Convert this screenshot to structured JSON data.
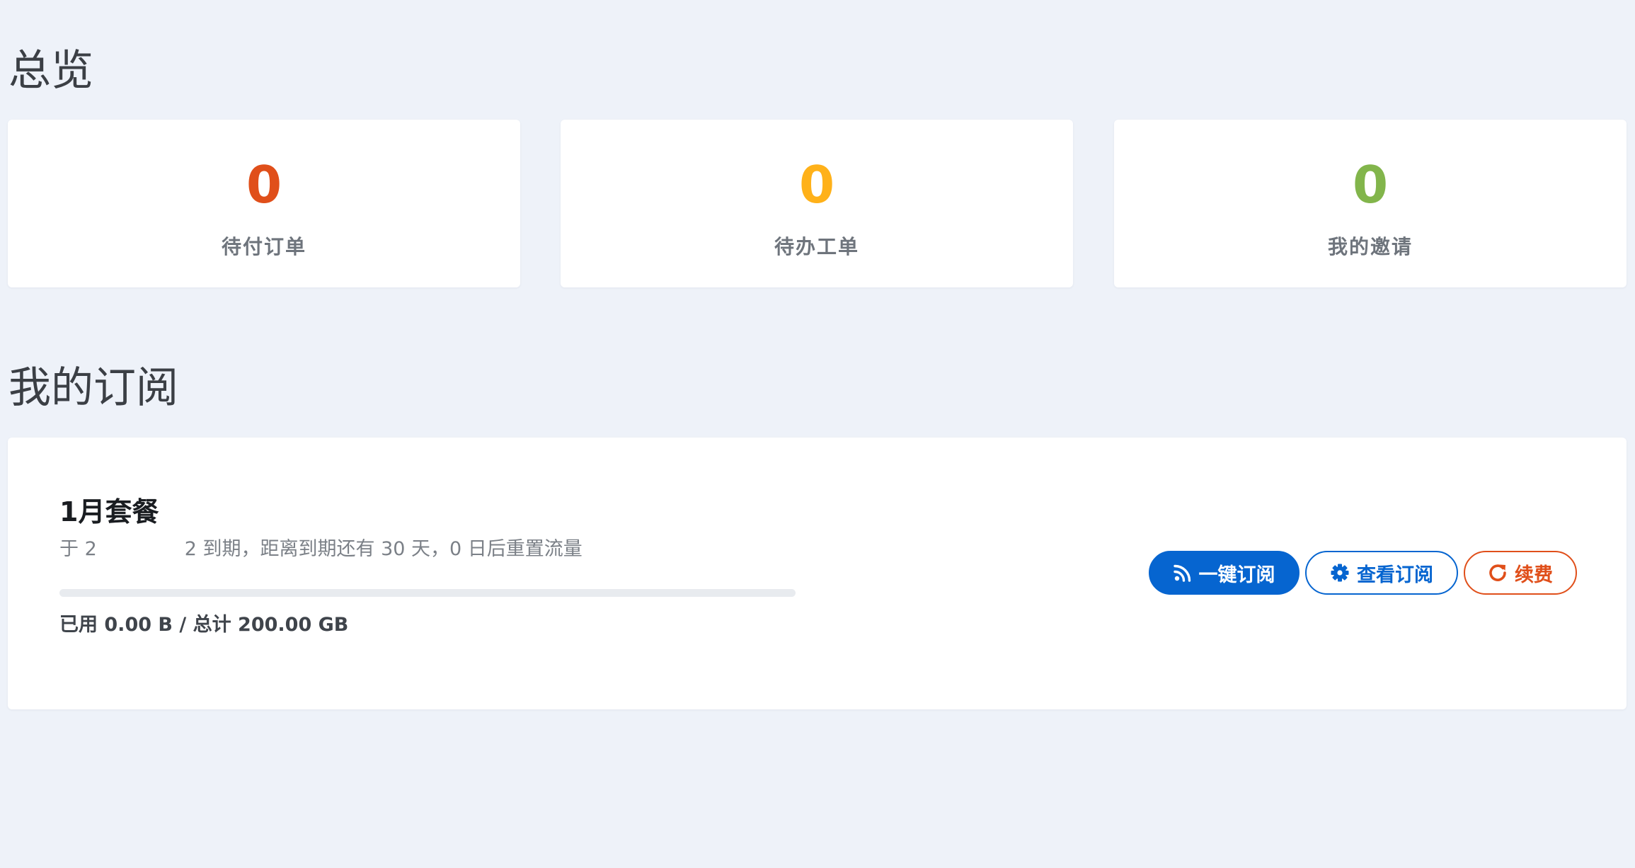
{
  "overview": {
    "title": "总览",
    "stats": [
      {
        "value": "0",
        "label": "待付订单",
        "color": "#e04f1a"
      },
      {
        "value": "0",
        "label": "待办工单",
        "color": "#ffb119"
      },
      {
        "value": "0",
        "label": "我的邀请",
        "color": "#82b54b"
      }
    ]
  },
  "subscriptions": {
    "title": "我的订阅",
    "plan": {
      "name": "1月套餐",
      "expiry_prefix": "于 2",
      "expiry_suffix": "2 到期，距离到期还有 30 天，0 日后重置流量",
      "usage_text": "已用 0.00 B / 总计 200.00 GB",
      "usage_fraction": 0
    },
    "actions": {
      "subscribe": {
        "label": "一键订阅",
        "icon": "rss-icon"
      },
      "view": {
        "label": "查看订阅",
        "icon": "gear-icon"
      },
      "renew": {
        "label": "续费",
        "icon": "redo-icon"
      }
    }
  },
  "colors": {
    "primary": "#0665d0",
    "danger": "#e04f1a",
    "warning": "#ffb119",
    "success": "#82b54b",
    "background": "#eef2f9"
  }
}
